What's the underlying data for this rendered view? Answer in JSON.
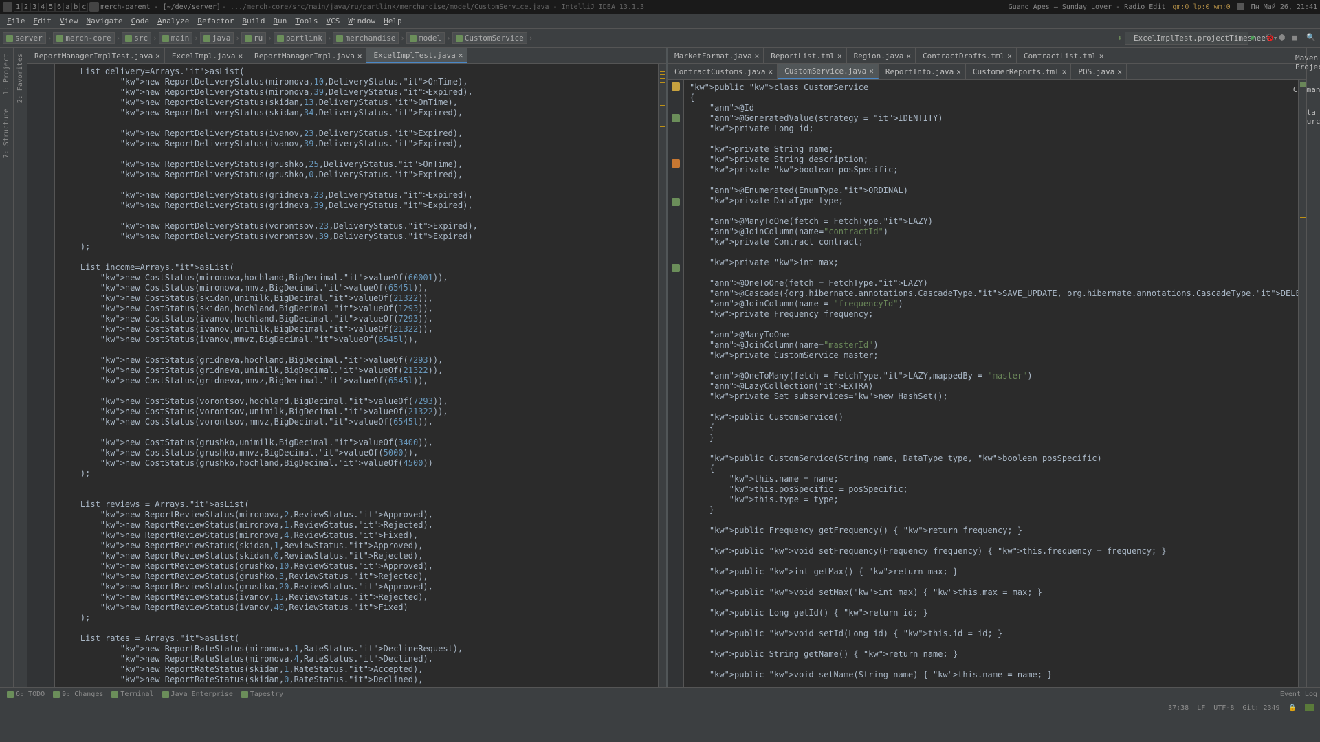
{
  "taskbar": {
    "nums": [
      "1",
      "2",
      "3",
      "4",
      "5",
      "6",
      "a",
      "b",
      "c"
    ],
    "title": "merch-parent - [~/dev/server]",
    "path": "- .../merch-core/src/main/java/ru/partlink/merchandise/model/CustomService.java - IntelliJ IDEA 13.1.3",
    "music": "Guano Apes — Sunday Lover - Radio Edit",
    "net": "gm:0 lp:0 wm:0",
    "date": "Пн Май 26, 21:41"
  },
  "titlebar": "",
  "menu": [
    "File",
    "Edit",
    "View",
    "Navigate",
    "Code",
    "Analyze",
    "Refactor",
    "Build",
    "Run",
    "Tools",
    "VCS",
    "Window",
    "Help"
  ],
  "breadcrumb": [
    "server",
    "merch-core",
    "src",
    "main",
    "java",
    "ru",
    "partlink",
    "merchandise",
    "model",
    "CustomService"
  ],
  "runconfig": "ExcelImplTest.projectTimesheet",
  "left_tabs": [
    "ReportManagerImplTest.java",
    "ExcelImpl.java",
    "ReportManagerImpl.java",
    "ExcelImplTest.java"
  ],
  "left_active": 3,
  "right_tabs_top": [
    "MarketFormat.java",
    "ReportList.tml",
    "Region.java",
    "ContractDrafts.tml",
    "ContractList.tml"
  ],
  "right_tabs_bot": [
    "ContractCustoms.java",
    "CustomService.java",
    "ReportInfo.java",
    "CustomerReports.tml",
    "POS.java"
  ],
  "right_active": 1,
  "sidetools_left": [
    "1: Project",
    "7: Structure"
  ],
  "sidetools_left2": [
    "2: Favorites"
  ],
  "sidetools_right": [
    "Maven Projects",
    "Commander",
    "Data Sources"
  ],
  "bottom": [
    "6: TODO",
    "9: Changes",
    "Terminal",
    "Java Enterprise",
    "Tapestry"
  ],
  "status": {
    "pos": "37:38",
    "sep": "LF",
    "enc": "UTF-8",
    "git": "Git: 2349",
    "lock": "🔒",
    "event": "Event Log"
  },
  "left_code": "    List<ReportDeliveryStatus> delivery=Arrays.asList(\n            new ReportDeliveryStatus(mironova,10,DeliveryStatus.OnTime),\n            new ReportDeliveryStatus(mironova,39,DeliveryStatus.Expired),\n            new ReportDeliveryStatus(skidan,13,DeliveryStatus.OnTime),\n            new ReportDeliveryStatus(skidan,34,DeliveryStatus.Expired),\n\n            new ReportDeliveryStatus(ivanov,23,DeliveryStatus.Expired),\n            new ReportDeliveryStatus(ivanov,39,DeliveryStatus.Expired),\n\n            new ReportDeliveryStatus(grushko,25,DeliveryStatus.OnTime),\n            new ReportDeliveryStatus(grushko,0,DeliveryStatus.Expired),\n\n            new ReportDeliveryStatus(gridneva,23,DeliveryStatus.Expired),\n            new ReportDeliveryStatus(gridneva,39,DeliveryStatus.Expired),\n\n            new ReportDeliveryStatus(vorontsov,23,DeliveryStatus.Expired),\n            new ReportDeliveryStatus(vorontsov,39,DeliveryStatus.Expired)\n    );\n\n    List<CostStatus> income=Arrays.asList(\n        new CostStatus(mironova,hochland,BigDecimal.valueOf(60001)),\n        new CostStatus(mironova,mmvz,BigDecimal.valueOf(6545l)),\n        new CostStatus(skidan,unimilk,BigDecimal.valueOf(21322)),\n        new CostStatus(skidan,hochland,BigDecimal.valueOf(1293)),\n        new CostStatus(ivanov,hochland,BigDecimal.valueOf(7293)),\n        new CostStatus(ivanov,unimilk,BigDecimal.valueOf(21322)),\n        new CostStatus(ivanov,mmvz,BigDecimal.valueOf(6545l)),\n\n        new CostStatus(gridneva,hochland,BigDecimal.valueOf(7293)),\n        new CostStatus(gridneva,unimilk,BigDecimal.valueOf(21322)),\n        new CostStatus(gridneva,mmvz,BigDecimal.valueOf(6545l)),\n\n        new CostStatus(vorontsov,hochland,BigDecimal.valueOf(7293)),\n        new CostStatus(vorontsov,unimilk,BigDecimal.valueOf(21322)),\n        new CostStatus(vorontsov,mmvz,BigDecimal.valueOf(6545l)),\n\n        new CostStatus(grushko,unimilk,BigDecimal.valueOf(3400)),\n        new CostStatus(grushko,mmvz,BigDecimal.valueOf(5000)),\n        new CostStatus(grushko,hochland,BigDecimal.valueOf(4500))\n    );\n\n\n    List<ReportReviewStatus> reviews = Arrays.asList(\n        new ReportReviewStatus(mironova,2,ReviewStatus.Approved),\n        new ReportReviewStatus(mironova,1,ReviewStatus.Rejected),\n        new ReportReviewStatus(mironova,4,ReviewStatus.Fixed),\n        new ReportReviewStatus(skidan,1,ReviewStatus.Approved),\n        new ReportReviewStatus(skidan,0,ReviewStatus.Rejected),\n        new ReportReviewStatus(grushko,10,ReviewStatus.Approved),\n        new ReportReviewStatus(grushko,3,ReviewStatus.Rejected),\n        new ReportReviewStatus(grushko,20,ReviewStatus.Approved),\n        new ReportReviewStatus(ivanov,15,ReviewStatus.Rejected),\n        new ReportReviewStatus(ivanov,40,ReviewStatus.Fixed)\n    );\n\n    List<ReportRateStatus> rates = Arrays.asList(\n            new ReportRateStatus(mironova,1,RateStatus.DeclineRequest),\n            new ReportRateStatus(mironova,4,RateStatus.Declined),\n            new ReportRateStatus(skidan,1,RateStatus.Accepted),\n            new ReportRateStatus(skidan,0,RateStatus.Declined),",
  "right_code": "public class CustomService\n{\n    @Id\n    @GeneratedValue(strategy = IDENTITY)\n    private Long id;\n\n    private String name;\n    private String description;\n    private boolean posSpecific;\n\n    @Enumerated(EnumType.ORDINAL)\n    private DataType type;\n\n    @ManyToOne(fetch = FetchType.LAZY)\n    @JoinColumn(name=\"contractId\")\n    private Contract contract;\n\n    private int max;\n\n    @OneToOne(fetch = FetchType.LAZY)\n    @Cascade({org.hibernate.annotations.CascadeType.SAVE_UPDATE, org.hibernate.annotations.CascadeType.DELETE})\n    @JoinColumn(name = \"frequencyId\")\n    private Frequency frequency;\n\n    @ManyToOne\n    @JoinColumn(name=\"masterId\")\n    private CustomService master;\n\n    @OneToMany(fetch = FetchType.LAZY,mappedBy = \"master\")\n    @LazyCollection(EXTRA)\n    private Set<CustomService> subservices=new HashSet<CustomService>();\n\n    public CustomService()\n    {\n    }\n\n    public CustomService(String name, DataType type, boolean posSpecific)\n    {\n        this.name = name;\n        this.posSpecific = posSpecific;\n        this.type = type;\n    }\n\n    public Frequency getFrequency() { return frequency; }\n\n    public void setFrequency(Frequency frequency) { this.frequency = frequency; }\n\n    public int getMax() { return max; }\n\n    public void setMax(int max) { this.max = max; }\n\n    public Long getId() { return id; }\n\n    public void setId(Long id) { this.id = id; }\n\n    public String getName() { return name; }\n\n    public void setName(String name) { this.name = name; }\n\n    public boolean isPosSpecific() { return posSpecific; }\n"
}
